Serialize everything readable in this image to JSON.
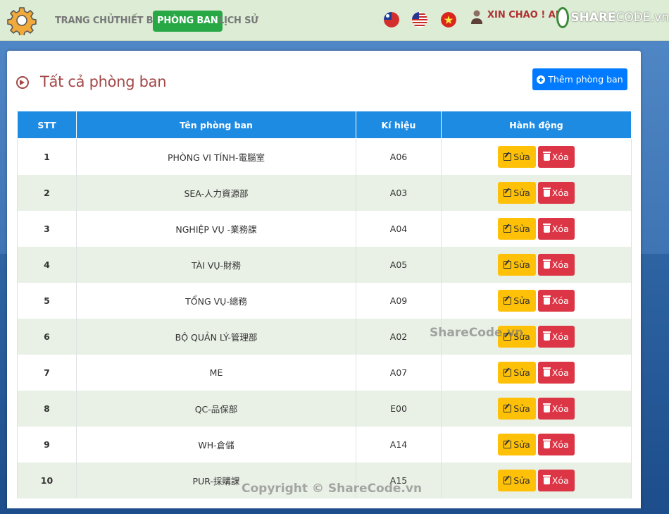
{
  "nav": {
    "items": [
      {
        "label": "TRANG CHỦ",
        "active": false
      },
      {
        "label": "THIẾT BỊ",
        "active": false
      },
      {
        "label": "PHÒNG BAN",
        "active": true
      },
      {
        "label": "LỊCH SỬ",
        "active": false
      }
    ],
    "flags": [
      "taiwan-flag-icon",
      "usa-flag-icon",
      "vietnam-flag-icon"
    ],
    "greeting": "XIN CHÀO ! ADM"
  },
  "logo": {
    "brand": "SHARE",
    "suffix": "CODE.vn"
  },
  "page": {
    "title": "Tất cả phòng ban",
    "add_button": "Thêm phòng ban"
  },
  "table": {
    "headers": [
      "STT",
      "Tên phòng ban",
      "Kí hiệu",
      "Hành động"
    ],
    "edit_label": "Sửa",
    "delete_label": "Xóa",
    "rows": [
      {
        "stt": "1",
        "name": "PHÒNG VI TÍNH-電腦室",
        "code": "A06"
      },
      {
        "stt": "2",
        "name": "SEA-人力資源部",
        "code": "A03"
      },
      {
        "stt": "3",
        "name": "NGHIỆP VỤ -業務課",
        "code": "A04"
      },
      {
        "stt": "4",
        "name": "TÀI VỤ-財務",
        "code": "A05"
      },
      {
        "stt": "5",
        "name": "TỔNG VỤ-總務",
        "code": "A09"
      },
      {
        "stt": "6",
        "name": "BỘ QUẢN LÝ-管理部",
        "code": "A02"
      },
      {
        "stt": "7",
        "name": "ME",
        "code": "A07"
      },
      {
        "stt": "8",
        "name": "QC-品保部",
        "code": "E00"
      },
      {
        "stt": "9",
        "name": "WH-倉儲",
        "code": "A14"
      },
      {
        "stt": "10",
        "name": "PUR-採購課",
        "code": "A15"
      }
    ]
  },
  "watermarks": [
    "ShareCode.vn",
    "Copyright © ShareCode.vn"
  ],
  "colors": {
    "navbar_bg": "#ddecd5",
    "active_nav": "#28a745",
    "table_header": "#1e8be3",
    "edit_button": "#ffc107",
    "delete_button": "#dc3545",
    "add_button": "#007bff",
    "title": "#a34747"
  }
}
